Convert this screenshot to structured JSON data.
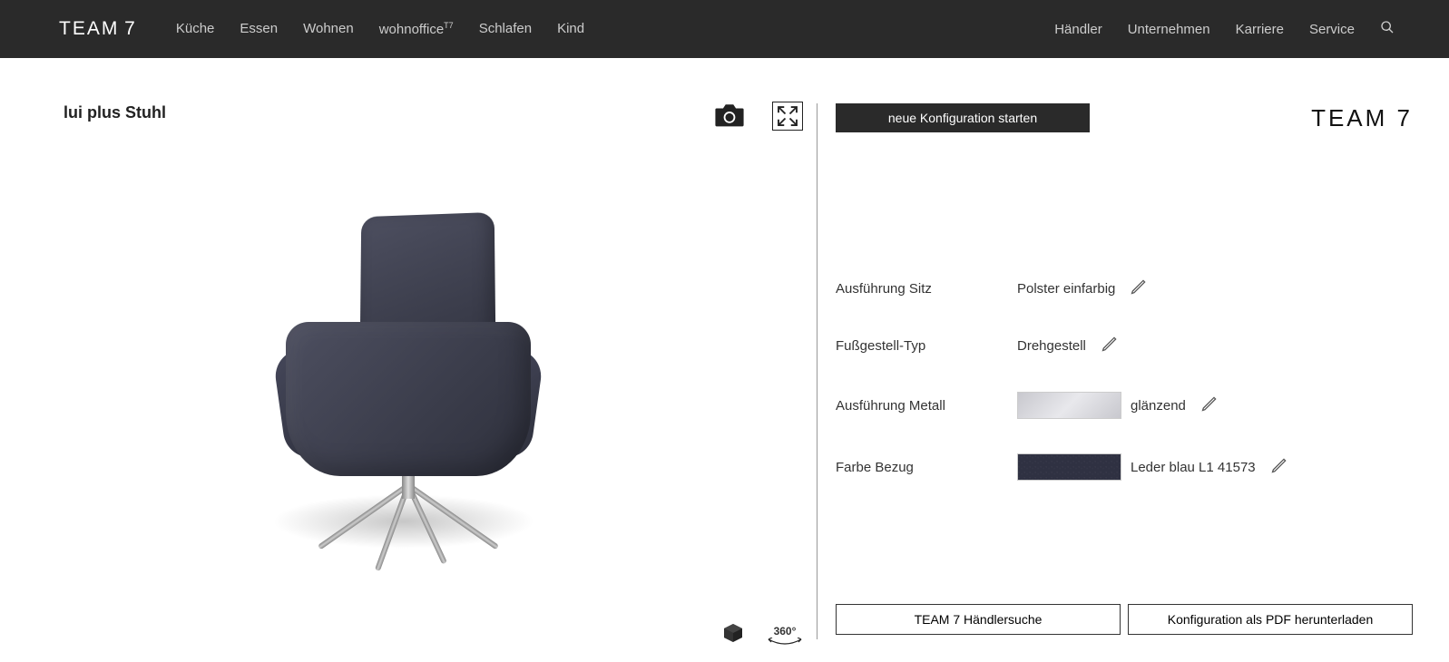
{
  "header": {
    "logo": "TEAM 7",
    "nav_primary": [
      "Küche",
      "Essen",
      "Wohnen",
      "wohnoffice",
      "Schlafen",
      "Kind"
    ],
    "wohnoffice_sup": "T7",
    "nav_secondary": [
      "Händler",
      "Unternehmen",
      "Karriere",
      "Service"
    ]
  },
  "viewer": {
    "product_title": "lui plus Stuhl",
    "rotate_label": "360°"
  },
  "panel": {
    "new_config": "neue Konfiguration starten",
    "logo": "TEAM 7",
    "rows": [
      {
        "label": "Ausführung Sitz",
        "value": "Polster einfarbig",
        "swatch": null
      },
      {
        "label": "Fußgestell-Typ",
        "value": "Drehgestell",
        "swatch": null
      },
      {
        "label": "Ausführung Metall",
        "value": "glänzend",
        "swatch": "metal"
      },
      {
        "label": "Farbe Bezug",
        "value": "Leder blau L1 41573",
        "swatch": "leather"
      }
    ],
    "actions": {
      "dealer": "TEAM 7 Händlersuche",
      "pdf": "Konfiguration als PDF herunterladen"
    }
  }
}
